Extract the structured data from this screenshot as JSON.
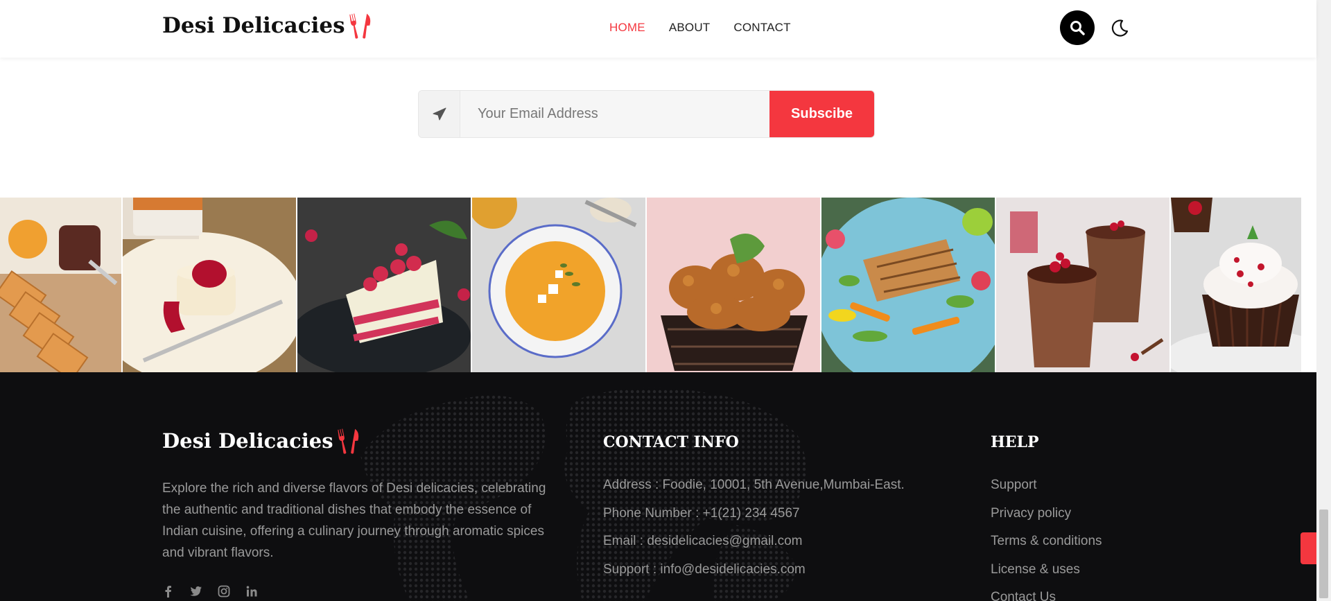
{
  "header": {
    "logo_text": "Desi Delicacies",
    "nav": [
      {
        "label": "HOME",
        "active": true
      },
      {
        "label": "ABOUT",
        "active": false
      },
      {
        "label": "CONTACT",
        "active": false
      }
    ]
  },
  "newsletter": {
    "email_placeholder": "Your Email Address",
    "subscribe_label": "Subscibe"
  },
  "gallery": {
    "items": [
      "bread-and-jam",
      "panna-cotta",
      "raspberry-cake",
      "pumpkin-soup",
      "fried-chicken",
      "grilled-fish-salad",
      "chocolate-mousse",
      "red-velvet-cupcake"
    ]
  },
  "footer": {
    "logo_text": "Desi Delicacies",
    "description": "Explore the rich and diverse flavors of Desi delicacies, celebrating the authentic and traditional dishes that embody the essence of Indian cuisine, offering a culinary journey through aromatic spices and vibrant flavors.",
    "social": [
      "facebook-icon",
      "twitter-icon",
      "instagram-icon",
      "linkedin-icon"
    ],
    "contact": {
      "title": "CONTACT INFO",
      "items": [
        "Address : Foodie, 10001, 5th Avenue,Mumbai-East.",
        "Phone Number : +1(21) 234 4567",
        "Email : desidelicacies@gmail.com",
        "Support : info@desidelicacies.com"
      ]
    },
    "help": {
      "title": "HELP",
      "items": [
        "Support",
        "Privacy policy",
        "Terms & conditions",
        "License & uses",
        "Contact Us"
      ]
    }
  },
  "colors": {
    "accent": "#f4373f",
    "footer_bg": "#0e0e10"
  }
}
